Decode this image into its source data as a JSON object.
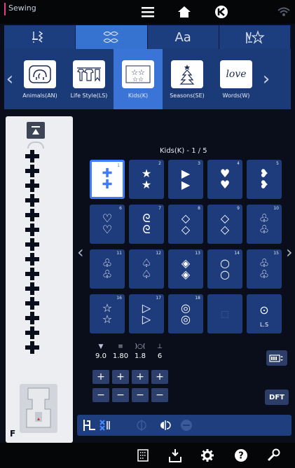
{
  "topbar": {
    "mode_label": "Sewing",
    "icons": [
      "menu-icon",
      "home-icon",
      "back-icon",
      "wifi-icon"
    ]
  },
  "category_tabs": [
    {
      "name": "utility-stitches-tab",
      "icon": "stitch-icon"
    },
    {
      "name": "decorative-stitches-tab",
      "icon": "decorative-icon",
      "active": true
    },
    {
      "name": "characters-tab",
      "label": "Aa"
    },
    {
      "name": "my-custom-stitch-tab",
      "icon": "custom-stitch-icon"
    }
  ],
  "categories": [
    {
      "label": "Animals(AN)",
      "thumb": "🐘"
    },
    {
      "label": "Life Style(LS)",
      "thumb": "👕"
    },
    {
      "label": "Kids(K)",
      "thumb": "★★",
      "active": true
    },
    {
      "label": "Seasons(SE)",
      "thumb": "🎄"
    },
    {
      "label": "Words(W)",
      "thumb": "love"
    }
  ],
  "pattern_title": "Kids(K) - 1 / 5",
  "patterns": [
    {
      "num": "1",
      "glyph": "✚\n✚",
      "active": true
    },
    {
      "num": "2",
      "glyph": "★\n★"
    },
    {
      "num": "3",
      "glyph": "▶\n▶"
    },
    {
      "num": "4",
      "glyph": "♥\n♥"
    },
    {
      "num": "5",
      "glyph": "❥\n❥"
    },
    {
      "num": "6",
      "glyph": "♡\n♡"
    },
    {
      "num": "7",
      "glyph": "ᘓ\nᘓ"
    },
    {
      "num": "8",
      "glyph": "◇\n◇"
    },
    {
      "num": "9",
      "glyph": "◇\n◇"
    },
    {
      "num": "10",
      "glyph": "♧\n♧"
    },
    {
      "num": "11",
      "glyph": "♧\n♧"
    },
    {
      "num": "12",
      "glyph": "♤\n♤"
    },
    {
      "num": "13",
      "glyph": "◈\n◈"
    },
    {
      "num": "14",
      "glyph": "○\n○"
    },
    {
      "num": "15",
      "glyph": "♧\n♧"
    },
    {
      "num": "16",
      "glyph": "☆\n☆"
    },
    {
      "num": "17",
      "glyph": "▷\n▷"
    },
    {
      "num": "18",
      "glyph": "◎\n◎"
    },
    {
      "num": "",
      "glyph": "⬚"
    },
    {
      "num": "",
      "glyph": "⊙",
      "label": "L.S"
    }
  ],
  "params": [
    {
      "name": "width",
      "icon": "▼",
      "value": "9.0"
    },
    {
      "name": "length",
      "icon": "≡",
      "value": "1.80"
    },
    {
      "name": "tension",
      "icon": ")○(",
      "value": "1.8"
    },
    {
      "name": "presser",
      "icon": "⊥",
      "value": "6"
    }
  ],
  "dft_label": "DFT",
  "foot_letter": "F",
  "colors": {
    "accent": "#3a74d6",
    "tab_bg": "#1b3b78",
    "bg": "#0a0e1a"
  }
}
